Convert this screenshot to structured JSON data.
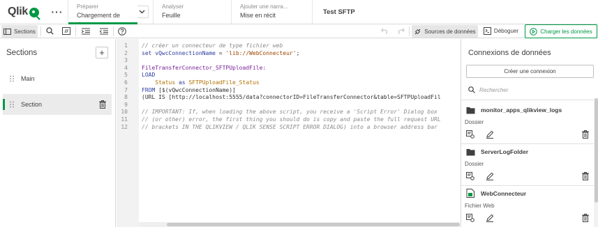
{
  "topbar": {
    "logo_text": "Qlik",
    "more_icon": "more-horizontal-icon",
    "tabs": [
      {
        "small": "Préparer",
        "big": "Chargement de d..."
      },
      {
        "small": "Analyser",
        "big": "Feuille"
      },
      {
        "small": "Ajouter une narra...",
        "big": "Mise en récit"
      }
    ],
    "app_title": "Test SFTP"
  },
  "toolbar": {
    "sections_label": "Sections",
    "data_sources_label": "Sources de données",
    "debug_label": "Déboguer",
    "load_data_label": "Charger les données"
  },
  "sections_panel": {
    "title": "Sections",
    "items": [
      {
        "label": "Main",
        "active": false
      },
      {
        "label": "Section",
        "active": true
      }
    ]
  },
  "editor": {
    "line_numbers": [
      "1",
      "2",
      "3",
      "4",
      "5",
      "6",
      "7",
      "8",
      "9",
      "10",
      "11",
      "12"
    ],
    "lines": [
      [
        {
          "t": "// créer un connecteur de type fichier web",
          "c": "comment"
        }
      ],
      [
        {
          "t": "set ",
          "c": "kw"
        },
        {
          "t": "vQwcConnectionName",
          "c": "kw"
        },
        {
          "t": " = ",
          "c": "plain"
        },
        {
          "t": "'lib://WebConnecteur'",
          "c": "str"
        },
        {
          "t": ";",
          "c": "plain"
        }
      ],
      [],
      [
        {
          "t": "FileTransferConnector_SFTPUploadFile:",
          "c": "label"
        }
      ],
      [
        {
          "t": "LOAD",
          "c": "kw"
        }
      ],
      [
        {
          "t": "    Status ",
          "c": "field"
        },
        {
          "t": "as ",
          "c": "kw"
        },
        {
          "t": "SFTPUploadFile_Status",
          "c": "field"
        }
      ],
      [
        {
          "t": "FROM ",
          "c": "kw"
        },
        {
          "t": "[$(vQwcConnectionName)]",
          "c": "plain"
        }
      ],
      [
        {
          "t": "(URL IS [http://localhost:5555/data?connectorID=FileTransferConnector&table=SFTPUploadFil",
          "c": "plain"
        }
      ],
      [],
      [
        {
          "t": "// IMPORTANT: If, when loading the above script, you receive a 'Script Error' Dialog box",
          "c": "comment"
        }
      ],
      [
        {
          "t": "// (or other) error, the first thing you should do is copy and paste the full request URL",
          "c": "comment"
        }
      ],
      [
        {
          "t": "// brackets IN THE QLIKVIEW / QLIK SENSE SCRIPT ERROR DIALOG) into a browser address bar",
          "c": "comment"
        }
      ]
    ]
  },
  "connections_panel": {
    "title": "Connexions de données",
    "create_label": "Créer une connexion",
    "search_placeholder": "Rechercher",
    "connections": [
      {
        "name": "monitor_apps_qlikview_logs",
        "type": "Dossier",
        "icon": "folder-icon"
      },
      {
        "name": "ServerLogFolder",
        "type": "Dossier",
        "icon": "folder-icon"
      },
      {
        "name": "WebConnecteur",
        "type": "Fichier Web",
        "icon": "web-file-icon"
      }
    ]
  },
  "colors": {
    "accent": "#009845",
    "comment": "#8a8a8a",
    "keyword": "#2c3b9e",
    "string": "#9c4600",
    "label": "#7a1f9a"
  }
}
